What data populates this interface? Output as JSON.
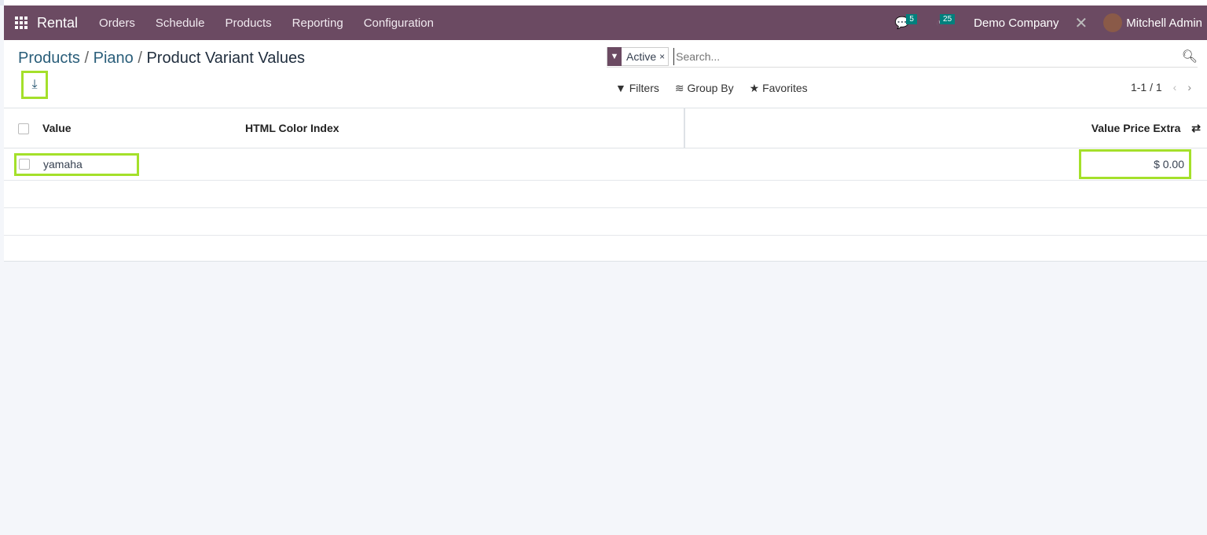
{
  "navbar": {
    "app": "Rental",
    "menus": [
      "Orders",
      "Schedule",
      "Products",
      "Reporting",
      "Configuration"
    ],
    "messages_count": "5",
    "activities_count": "25",
    "company": "Demo Company",
    "user": "Mitchell Admin",
    "color": "#6b4a62"
  },
  "breadcrumb": {
    "items": [
      "Products",
      "Piano"
    ],
    "current": "Product Variant Values",
    "sep": "/"
  },
  "search": {
    "facet": "Active",
    "placeholder": "Search..."
  },
  "controls": {
    "filters": "Filters",
    "group_by": "Group By",
    "favorites": "Favorites",
    "pager": "1-1 / 1"
  },
  "table": {
    "headers": [
      "Value",
      "HTML Color Index",
      "Value Price Extra"
    ],
    "rows": [
      {
        "value": "yamaha",
        "color_index": "",
        "price_extra": "$ 0.00"
      }
    ]
  },
  "highlight_color": "#a4e02a"
}
